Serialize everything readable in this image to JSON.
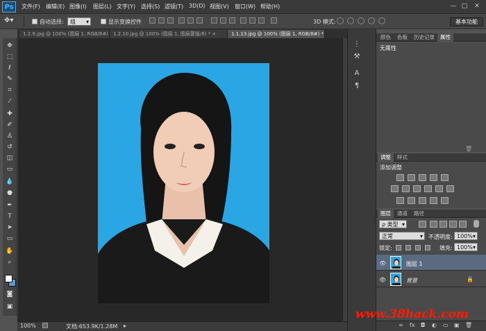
{
  "app": {
    "logo": "Ps"
  },
  "menu": [
    "文件(F)",
    "编辑(E)",
    "图像(I)",
    "图层(L)",
    "文字(Y)",
    "选择(S)",
    "滤镜(T)",
    "3D(D)",
    "视图(V)",
    "窗口(W)",
    "帮助(H)"
  ],
  "window_controls": [
    "—",
    "□",
    "✕"
  ],
  "options": {
    "auto_select_label": "自动选择:",
    "auto_select_value": "组",
    "show_transform_label": "显示变换控件",
    "mode_3d_label": "3D 模式:",
    "workspace_button": "基本功能"
  },
  "doc_tabs": [
    {
      "label": "1.2.9.jpg @ 100% (图层 1, RGB/8#) *",
      "close": "×",
      "active": false
    },
    {
      "label": "1.2.10.jpg @ 100% (图层 1, 图层蒙版/8) *",
      "close": "×",
      "active": false
    },
    {
      "label": "1.1.13.jpg @ 100% (图层 1, RGB/8#) *",
      "close": "×",
      "active": true
    }
  ],
  "status": {
    "zoom": "100%",
    "doc_info": "文档:653.9K/1.28M",
    "arrow": "▸"
  },
  "properties_panel": {
    "tabs": [
      "颜色",
      "色板",
      "历史记录",
      "属性"
    ],
    "active_tab": "属性",
    "content": "无属性"
  },
  "adjustments_panel": {
    "tabs": [
      "调整",
      "样式"
    ],
    "title": "添加调整"
  },
  "layers_panel": {
    "tabs": [
      "图层",
      "通道",
      "路径"
    ],
    "filter_label": "ρ 类型",
    "blend_mode": "正常",
    "opacity_label": "不透明度:",
    "opacity_value": "100%",
    "lock_label": "锁定:",
    "fill_label": "填充:",
    "fill_value": "100%",
    "layers": [
      {
        "name": "图层 1",
        "selected": true,
        "locked": false
      },
      {
        "name": "背景",
        "selected": false,
        "locked": true
      }
    ]
  },
  "watermark": "www.38hack.com",
  "colors": {
    "accent": "#2aa6e4",
    "selected_layer": "#5a6a80",
    "watermark": "#ff1a00",
    "background_swatch": "#5b9cd6"
  }
}
